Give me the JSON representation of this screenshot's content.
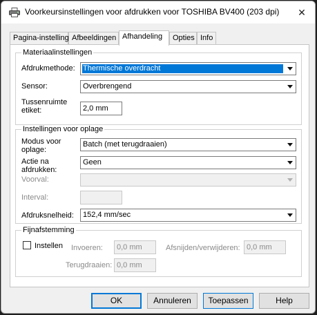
{
  "window": {
    "title": "Voorkeursinstellingen voor afdrukken voor TOSHIBA BV400 (203 dpi)",
    "close_glyph": "✕"
  },
  "tabs": [
    {
      "label": "Pagina-instelling"
    },
    {
      "label": "Afbeeldingen"
    },
    {
      "label": "Afhandeling",
      "active": true
    },
    {
      "label": "Opties"
    },
    {
      "label": "Info"
    }
  ],
  "material": {
    "legend": "Materiaalinstellingen",
    "method_label": "Afdrukmethode:",
    "method_value": "Thermische overdracht",
    "sensor_label": "Sensor:",
    "sensor_value": "Overbrengend",
    "gap_label_1": "Tussenruimte",
    "gap_label_2": "etiket:",
    "gap_value": "2,0 mm"
  },
  "batch": {
    "legend": "Instellingen voor oplage",
    "mode_label_1": "Modus voor",
    "mode_label_2": "oplage:",
    "mode_value": "Batch (met terugdraaien)",
    "action_label_1": "Actie na",
    "action_label_2": "afdrukken:",
    "action_value": "Geen",
    "event_label": "Voorval:",
    "event_value": "",
    "interval_label": "Interval:",
    "interval_value": "",
    "speed_label": "Afdruksnelheid:",
    "speed_value": "152,4 mm/sec"
  },
  "finetune": {
    "legend": "Fijnafstemming",
    "enable_label": "Instellen",
    "feed_label": "Invoeren:",
    "feed_value": "0,0 mm",
    "cut_label": "Afsnijden/verwijderen:",
    "cut_value": "0,0 mm",
    "backfeed_label": "Terugdraaien:",
    "backfeed_value": "0,0 mm"
  },
  "buttons": {
    "ok": "OK",
    "cancel": "Annuleren",
    "apply": "Toepassen",
    "help": "Help"
  },
  "colors": {
    "accent": "#0078d7",
    "window_bg": "#f0f0f0",
    "panel_bg": "#ffffff"
  },
  "icons": {
    "app": "printer-icon",
    "close": "close-icon",
    "dropdown": "chevron-down-icon"
  }
}
